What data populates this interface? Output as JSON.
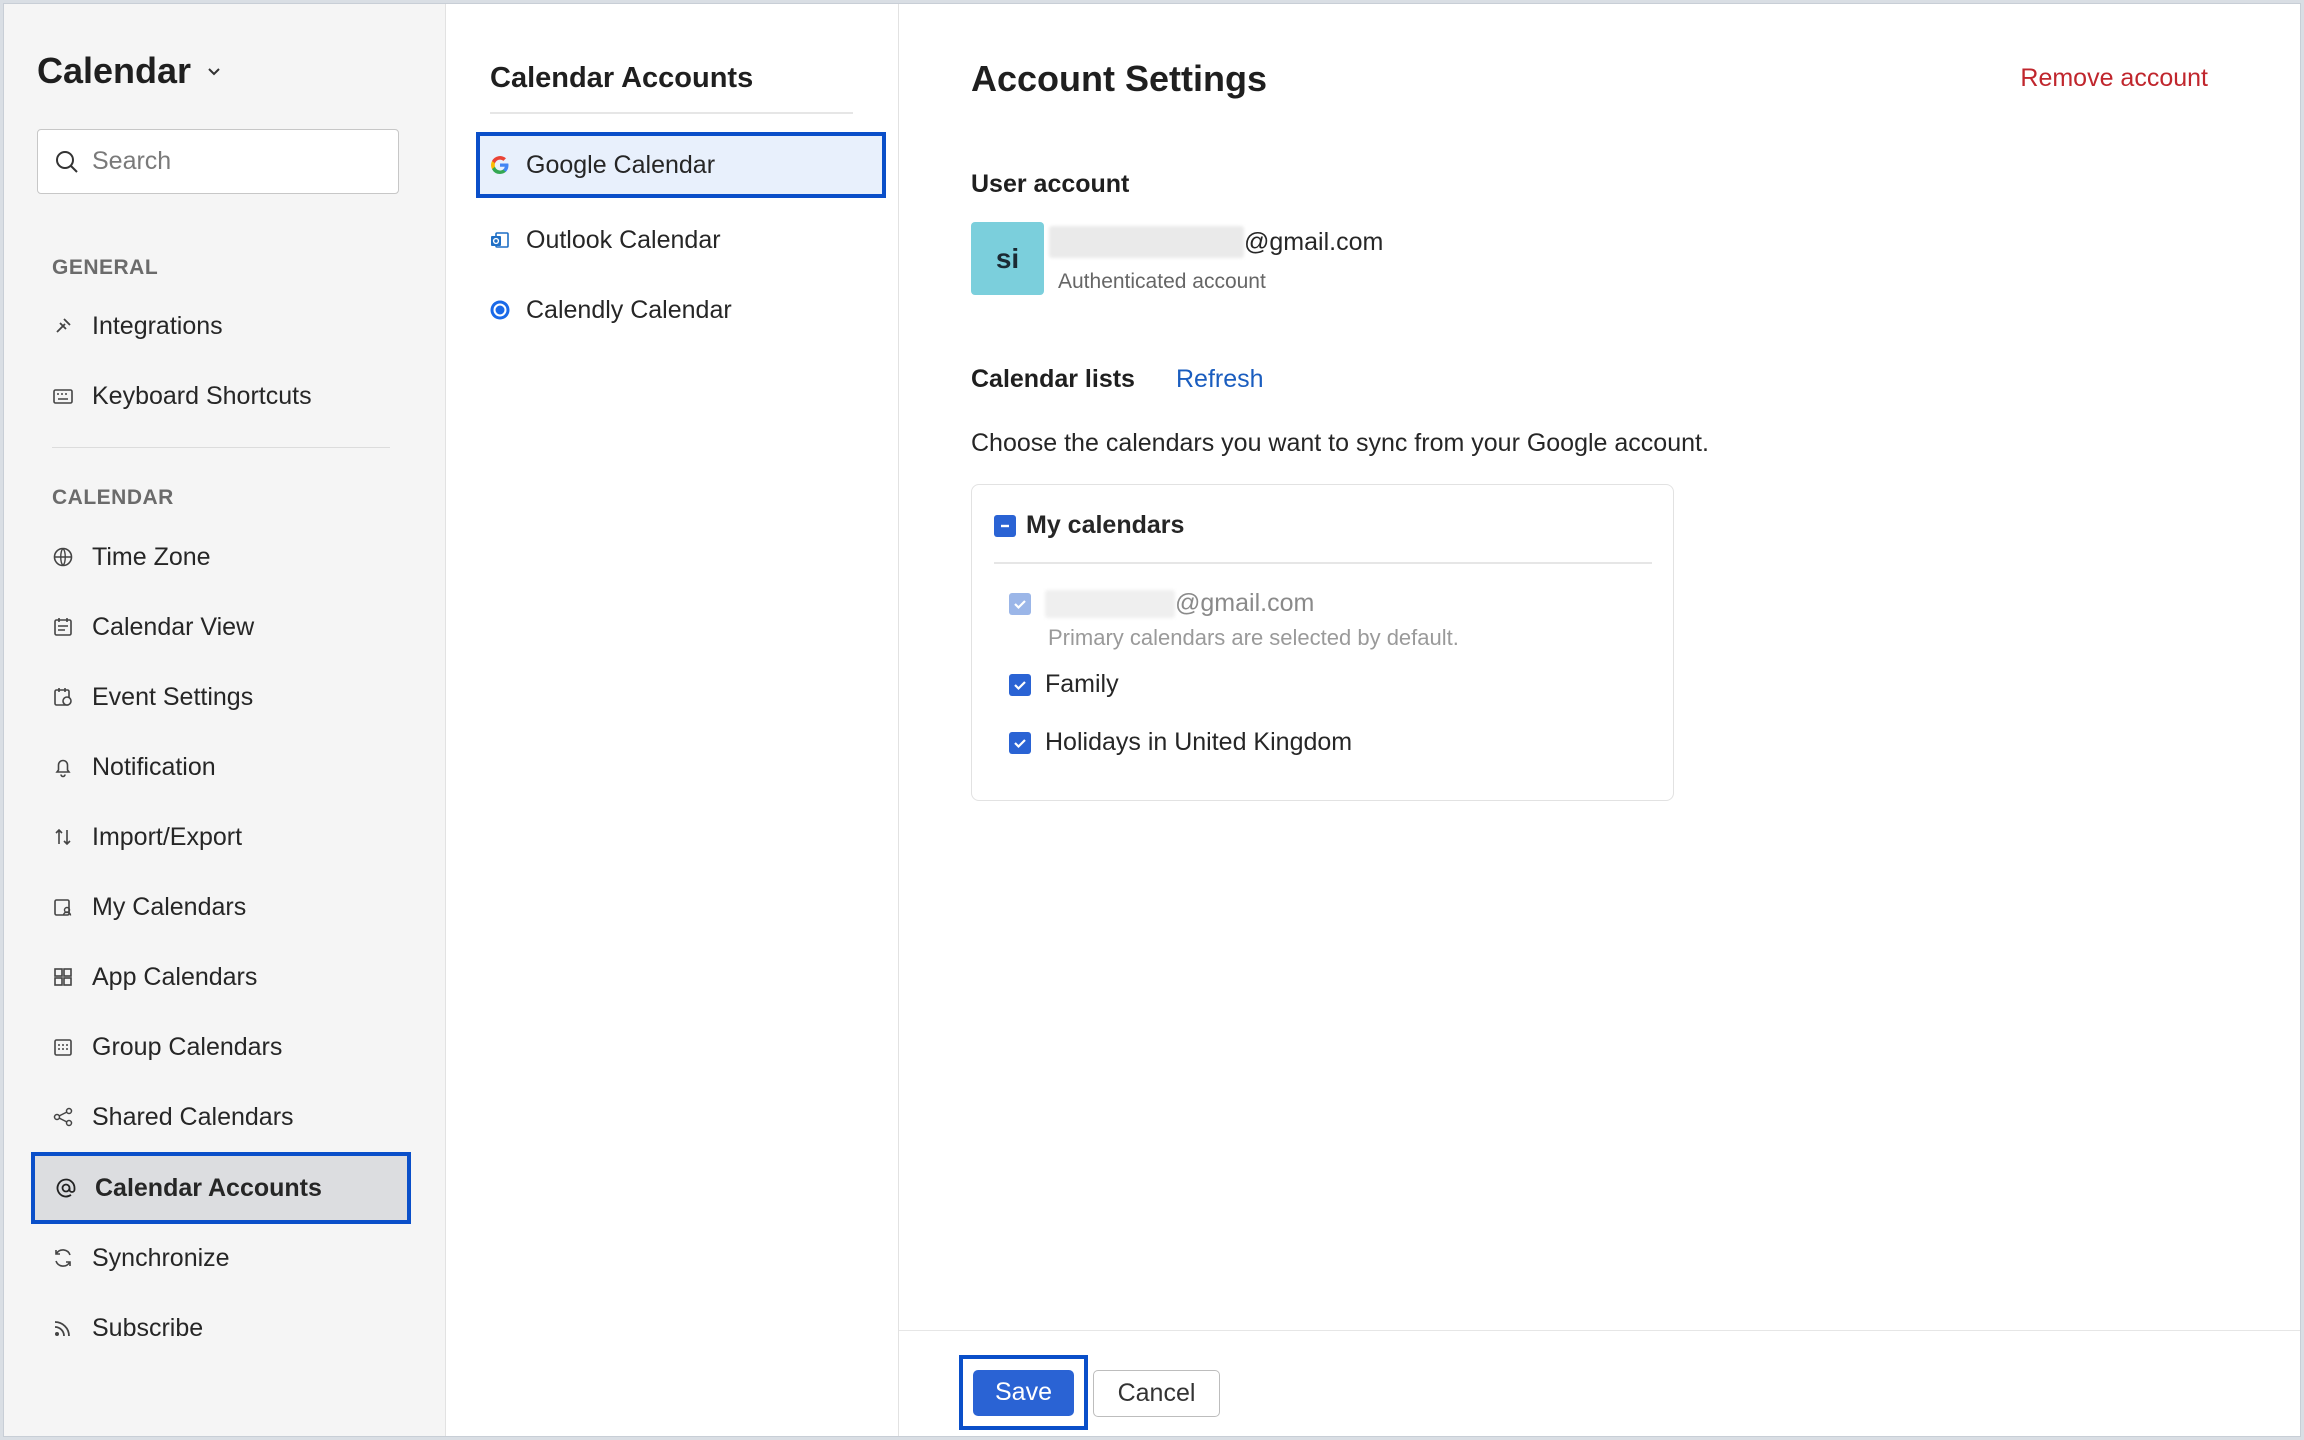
{
  "sidebar": {
    "app_title": "Calendar",
    "search_placeholder": "Search",
    "sections": {
      "general": "GENERAL",
      "calendar": "CALENDAR"
    },
    "general_items": [
      {
        "label": "Integrations",
        "icon": "plug-icon"
      },
      {
        "label": "Keyboard Shortcuts",
        "icon": "keyboard-icon"
      }
    ],
    "calendar_items": [
      {
        "label": "Time Zone",
        "icon": "globe-icon"
      },
      {
        "label": "Calendar View",
        "icon": "calendar-view-icon"
      },
      {
        "label": "Event Settings",
        "icon": "event-settings-icon"
      },
      {
        "label": "Notification",
        "icon": "bell-icon"
      },
      {
        "label": "Import/Export",
        "icon": "import-export-icon"
      },
      {
        "label": "My Calendars",
        "icon": "my-calendars-icon"
      },
      {
        "label": "App Calendars",
        "icon": "app-grid-icon"
      },
      {
        "label": "Group Calendars",
        "icon": "group-calendar-icon"
      },
      {
        "label": "Shared Calendars",
        "icon": "share-icon"
      },
      {
        "label": "Calendar Accounts",
        "icon": "at-icon",
        "active": true
      },
      {
        "label": "Synchronize",
        "icon": "sync-icon"
      },
      {
        "label": "Subscribe",
        "icon": "rss-icon"
      }
    ]
  },
  "accounts_panel": {
    "title": "Calendar Accounts",
    "items": [
      {
        "label": "Google Calendar",
        "icon": "google-icon",
        "active": true
      },
      {
        "label": "Outlook Calendar",
        "icon": "outlook-icon"
      },
      {
        "label": "Calendly Calendar",
        "icon": "calendly-icon"
      }
    ]
  },
  "main": {
    "title": "Account Settings",
    "remove_label": "Remove account",
    "user_account_heading": "User account",
    "avatar_initials": "si",
    "email_domain": "@gmail.com",
    "auth_label": "Authenticated account",
    "calendar_lists_heading": "Calendar lists",
    "refresh_label": "Refresh",
    "choose_text": "Choose the calendars you want to sync from your Google account.",
    "my_calendars_label": "My calendars",
    "calendars": [
      {
        "label": "@gmail.com",
        "checked": true,
        "disabled": true
      },
      {
        "label": "Family",
        "checked": true
      },
      {
        "label": "Holidays in United Kingdom",
        "checked": true
      }
    ],
    "primary_note": "Primary calendars are selected by default.",
    "save_label": "Save",
    "cancel_label": "Cancel"
  },
  "colors": {
    "accent": "#2a63d4",
    "highlight_border": "#0a4fc9",
    "danger": "#c0262d",
    "avatar_bg": "#7bcfdc"
  }
}
